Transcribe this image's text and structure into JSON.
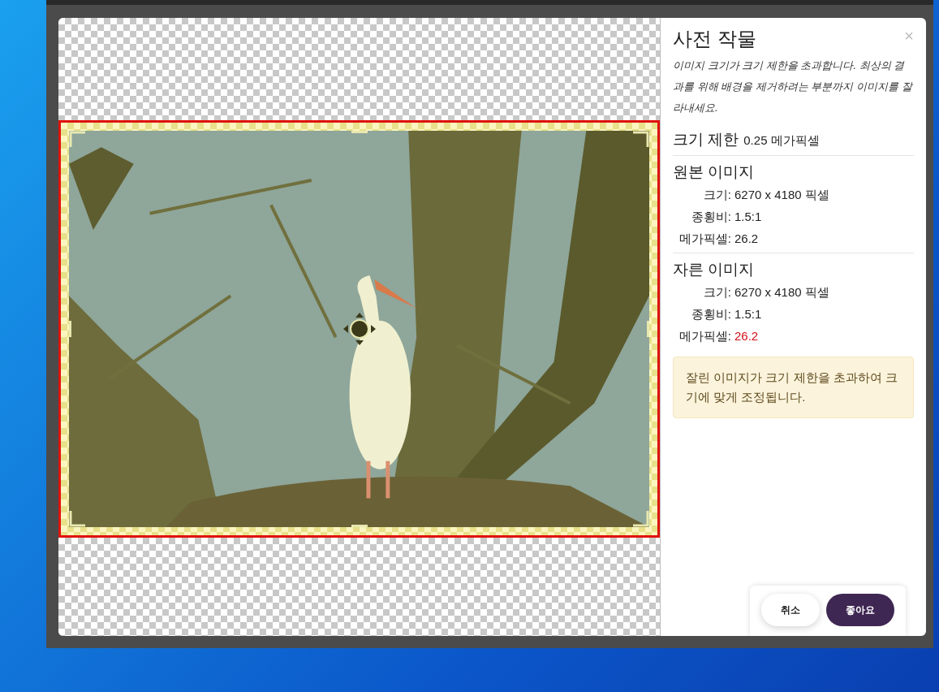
{
  "dialog": {
    "title": "사전 작물",
    "close": "×",
    "description": "이미지 크기가 크기 제한을 초과합니다. 최상의 결과를 위해 배경을 제거하려는 부분까지 이미지를 잘라내세요.",
    "size_limit": {
      "label": "크기 제한",
      "value": "0.25 메가픽셀"
    },
    "sections": [
      {
        "title": "원본 이미지",
        "rows": [
          {
            "label": "크기:",
            "value": "6270 x 4180 픽셀",
            "exceeds": false
          },
          {
            "label": "종횡비:",
            "value": "1.5:1",
            "exceeds": false
          },
          {
            "label": "메가픽셀:",
            "value": "26.2",
            "exceeds": false
          }
        ]
      },
      {
        "title": "자른 이미지",
        "rows": [
          {
            "label": "크기:",
            "value": "6270 x 4180 픽셀",
            "exceeds": false
          },
          {
            "label": "종횡비:",
            "value": "1.5:1",
            "exceeds": false
          },
          {
            "label": "메가픽셀:",
            "value": "26.2",
            "exceeds": true
          }
        ]
      }
    ],
    "warning": "잘린 이미지가 크기 제한을 초과하여 크기에 맞게 조정됩니다.",
    "buttons": [
      {
        "label": "취소",
        "kind": "secondary"
      },
      {
        "label": "좋아요",
        "kind": "primary"
      }
    ]
  }
}
